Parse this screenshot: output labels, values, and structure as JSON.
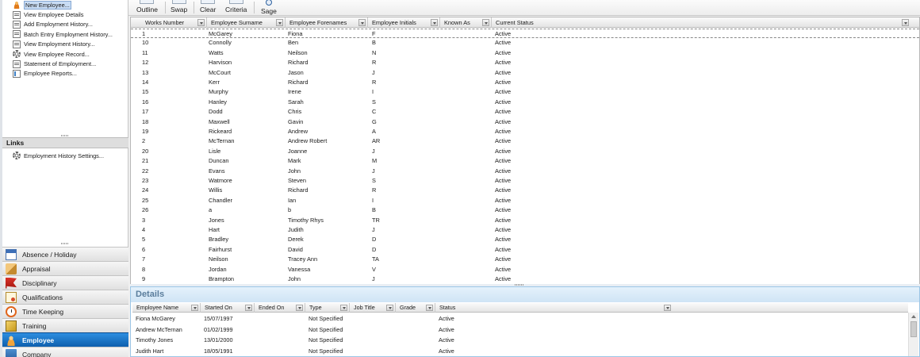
{
  "toolbar": {
    "buttons": [
      {
        "label": "Outline"
      },
      {
        "label": "Swap"
      },
      {
        "label": "Clear"
      },
      {
        "label": "Criteria"
      },
      {
        "label": "Sage"
      }
    ]
  },
  "tasks": [
    {
      "label": "New Employee...",
      "icon": "person-icon"
    },
    {
      "label": "View Employee Details",
      "icon": "document-icon"
    },
    {
      "label": "Add Employment History...",
      "icon": "document-icon"
    },
    {
      "label": "Batch Entry Employment History...",
      "icon": "document-icon"
    },
    {
      "label": "View Employment History...",
      "icon": "document-icon"
    },
    {
      "label": "View Employee Record...",
      "icon": "gear-icon"
    },
    {
      "label": "Statement of Employment...",
      "icon": "document-icon"
    },
    {
      "label": "Employee Reports...",
      "icon": "report-icon"
    }
  ],
  "links": {
    "title": "Links",
    "items": [
      {
        "label": "Employment History Settings...",
        "icon": "gear-icon"
      }
    ]
  },
  "nav": [
    {
      "label": "Absence / Holiday",
      "icon": "calendar-icon"
    },
    {
      "label": "Appraisal",
      "icon": "appraisal-icon"
    },
    {
      "label": "Disciplinary",
      "icon": "flag-icon"
    },
    {
      "label": "Qualifications",
      "icon": "certificate-icon"
    },
    {
      "label": "Time Keeping",
      "icon": "clock-icon"
    },
    {
      "label": "Training",
      "icon": "training-icon"
    },
    {
      "label": "Employee",
      "icon": "employee-icon"
    },
    {
      "label": "Company",
      "icon": "company-icon"
    }
  ],
  "grid": {
    "columns": [
      "Works Number",
      "Employee Surname",
      "Employee Forenames",
      "Employee Initials",
      "Known As",
      "Current Status"
    ],
    "rows": [
      [
        "1",
        "McGarey",
        "Fiona",
        "F",
        "",
        "Active"
      ],
      [
        "10",
        "Connolly",
        "Ben",
        "B",
        "",
        "Active"
      ],
      [
        "11",
        "Watts",
        "Neilson",
        "N",
        "",
        "Active"
      ],
      [
        "12",
        "Harvison",
        "Richard",
        "R",
        "",
        "Active"
      ],
      [
        "13",
        "McCourt",
        "Jason",
        "J",
        "",
        "Active"
      ],
      [
        "14",
        "Kerr",
        "Richard",
        "R",
        "",
        "Active"
      ],
      [
        "15",
        "Murphy",
        "Irene",
        "I",
        "",
        "Active"
      ],
      [
        "16",
        "Hanley",
        "Sarah",
        "S",
        "",
        "Active"
      ],
      [
        "17",
        "Dodd",
        "Chris",
        "C",
        "",
        "Active"
      ],
      [
        "18",
        "Maxwell",
        "Gavin",
        "G",
        "",
        "Active"
      ],
      [
        "19",
        "Rickeard",
        "Andrew",
        "A",
        "",
        "Active"
      ],
      [
        "2",
        "McTernan",
        "Andrew Robert",
        "AR",
        "",
        "Active"
      ],
      [
        "20",
        "Lisle",
        "Joanne",
        "J",
        "",
        "Active"
      ],
      [
        "21",
        "Duncan",
        "Mark",
        "M",
        "",
        "Active"
      ],
      [
        "22",
        "Evans",
        "John",
        "J",
        "",
        "Active"
      ],
      [
        "23",
        "Watmore",
        "Steven",
        "S",
        "",
        "Active"
      ],
      [
        "24",
        "Willis",
        "Richard",
        "R",
        "",
        "Active"
      ],
      [
        "25",
        "Chandler",
        "Ian",
        "I",
        "",
        "Active"
      ],
      [
        "26",
        "a",
        "b",
        "B",
        "",
        "Active"
      ],
      [
        "3",
        "Jones",
        "Timothy Rhys",
        "TR",
        "",
        "Active"
      ],
      [
        "4",
        "Hart",
        "Judith",
        "J",
        "",
        "Active"
      ],
      [
        "5",
        "Bradley",
        "Derek",
        "D",
        "",
        "Active"
      ],
      [
        "6",
        "Fairhurst",
        "David",
        "D",
        "",
        "Active"
      ],
      [
        "7",
        "Neilson",
        "Tracey Ann",
        "TA",
        "",
        "Active"
      ],
      [
        "8",
        "Jordan",
        "Vanessa",
        "V",
        "",
        "Active"
      ],
      [
        "9",
        "Brampton",
        "John",
        "J",
        "",
        "Active"
      ]
    ]
  },
  "details": {
    "title": "Details",
    "columns": [
      "Employee Name",
      "Started On",
      "Ended On",
      "Type",
      "Job Title",
      "Grade",
      "Status"
    ],
    "rows": [
      [
        "Fiona McGarey",
        "15/07/1997",
        "",
        "Not Specified",
        "",
        "",
        "Active"
      ],
      [
        "Andrew McTernan",
        "01/02/1999",
        "",
        "Not Specified",
        "",
        "",
        "Active"
      ],
      [
        "Timothy Jones",
        "13/01/2000",
        "",
        "Not Specified",
        "",
        "",
        "Active"
      ],
      [
        "Judith Hart",
        "18/05/1991",
        "",
        "Not Specified",
        "",
        "",
        "Active"
      ]
    ]
  }
}
